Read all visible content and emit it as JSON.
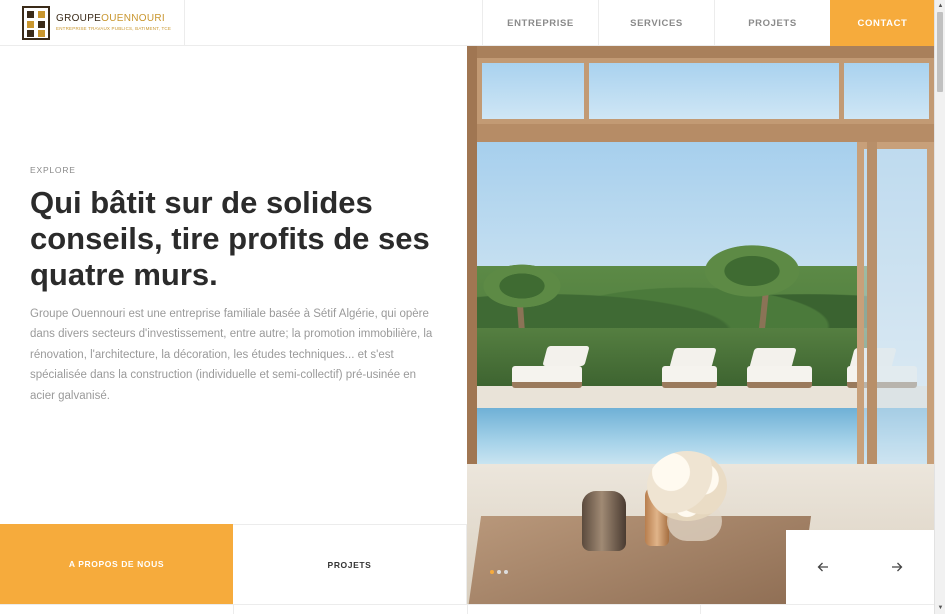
{
  "header": {
    "logo": {
      "title_main": "GROUPE",
      "title_accent": "OUENNOURI",
      "subtitle": "ENTREPRISE TRAVAUX PUBLICS, BATIMENT, TCE",
      "icon": "logo-mark"
    },
    "nav": [
      {
        "label": "ENTREPRISE"
      },
      {
        "label": "SERVICES"
      },
      {
        "label": "PROJETS"
      },
      {
        "label": "CONTACT"
      }
    ]
  },
  "hero": {
    "eyebrow": "EXPLORE",
    "headline": "Qui bâtit sur de solides conseils, tire profits de ses quatre murs.",
    "description": "Groupe Ouennouri est une entreprise familiale basée à Sétif Algérie, qui opère dans divers secteurs d'investissement, entre autre; la promotion immobilière, la rénovation, l'architecture, la décoration, les études techniques... et s'est spécialisée dans la construction (individuelle et semi-collectif) pré-usinée en acier galvanisé.",
    "slider": {
      "total_slides": 3,
      "active_slide": 1
    }
  },
  "bottom_bar": {
    "about_label": "A PROPOS DE NOUS",
    "projects_label": "PROJETS",
    "prev_icon": "arrow-left-icon",
    "next_icon": "arrow-right-icon"
  },
  "colors": {
    "accent": "#f6ab3c",
    "heading": "#2b2b2b",
    "body_text": "#9a9a9a",
    "nav_text": "#8a8a8a"
  }
}
